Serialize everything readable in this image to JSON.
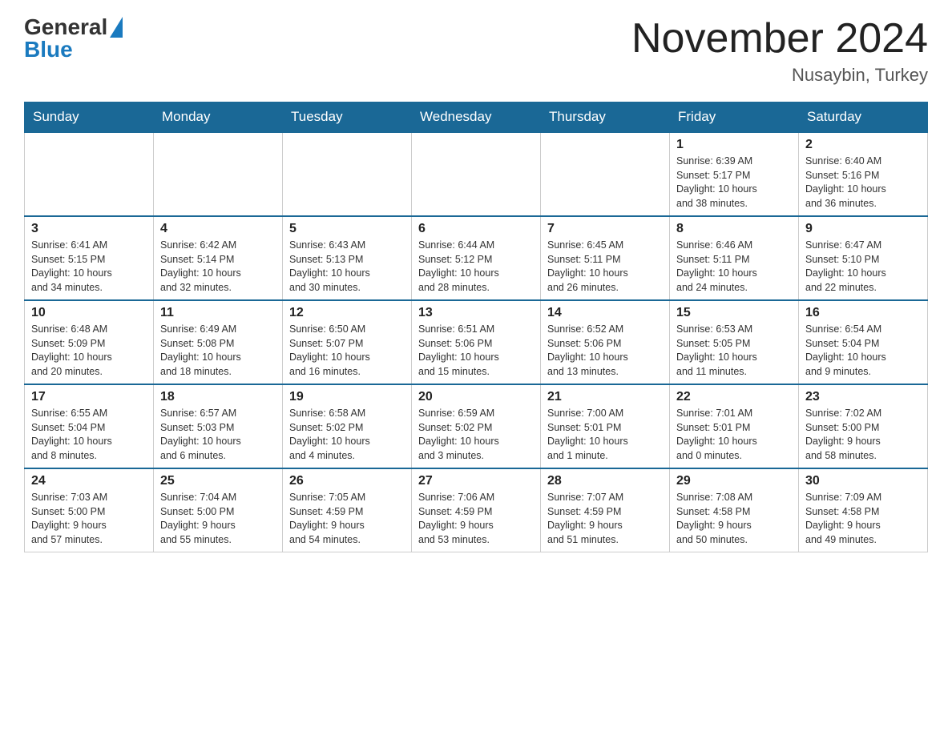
{
  "header": {
    "logo": {
      "general": "General",
      "blue": "Blue"
    },
    "title": "November 2024",
    "location": "Nusaybin, Turkey"
  },
  "calendar": {
    "days_of_week": [
      "Sunday",
      "Monday",
      "Tuesday",
      "Wednesday",
      "Thursday",
      "Friday",
      "Saturday"
    ],
    "weeks": [
      [
        {
          "day": "",
          "info": ""
        },
        {
          "day": "",
          "info": ""
        },
        {
          "day": "",
          "info": ""
        },
        {
          "day": "",
          "info": ""
        },
        {
          "day": "",
          "info": ""
        },
        {
          "day": "1",
          "info": "Sunrise: 6:39 AM\nSunset: 5:17 PM\nDaylight: 10 hours\nand 38 minutes."
        },
        {
          "day": "2",
          "info": "Sunrise: 6:40 AM\nSunset: 5:16 PM\nDaylight: 10 hours\nand 36 minutes."
        }
      ],
      [
        {
          "day": "3",
          "info": "Sunrise: 6:41 AM\nSunset: 5:15 PM\nDaylight: 10 hours\nand 34 minutes."
        },
        {
          "day": "4",
          "info": "Sunrise: 6:42 AM\nSunset: 5:14 PM\nDaylight: 10 hours\nand 32 minutes."
        },
        {
          "day": "5",
          "info": "Sunrise: 6:43 AM\nSunset: 5:13 PM\nDaylight: 10 hours\nand 30 minutes."
        },
        {
          "day": "6",
          "info": "Sunrise: 6:44 AM\nSunset: 5:12 PM\nDaylight: 10 hours\nand 28 minutes."
        },
        {
          "day": "7",
          "info": "Sunrise: 6:45 AM\nSunset: 5:11 PM\nDaylight: 10 hours\nand 26 minutes."
        },
        {
          "day": "8",
          "info": "Sunrise: 6:46 AM\nSunset: 5:11 PM\nDaylight: 10 hours\nand 24 minutes."
        },
        {
          "day": "9",
          "info": "Sunrise: 6:47 AM\nSunset: 5:10 PM\nDaylight: 10 hours\nand 22 minutes."
        }
      ],
      [
        {
          "day": "10",
          "info": "Sunrise: 6:48 AM\nSunset: 5:09 PM\nDaylight: 10 hours\nand 20 minutes."
        },
        {
          "day": "11",
          "info": "Sunrise: 6:49 AM\nSunset: 5:08 PM\nDaylight: 10 hours\nand 18 minutes."
        },
        {
          "day": "12",
          "info": "Sunrise: 6:50 AM\nSunset: 5:07 PM\nDaylight: 10 hours\nand 16 minutes."
        },
        {
          "day": "13",
          "info": "Sunrise: 6:51 AM\nSunset: 5:06 PM\nDaylight: 10 hours\nand 15 minutes."
        },
        {
          "day": "14",
          "info": "Sunrise: 6:52 AM\nSunset: 5:06 PM\nDaylight: 10 hours\nand 13 minutes."
        },
        {
          "day": "15",
          "info": "Sunrise: 6:53 AM\nSunset: 5:05 PM\nDaylight: 10 hours\nand 11 minutes."
        },
        {
          "day": "16",
          "info": "Sunrise: 6:54 AM\nSunset: 5:04 PM\nDaylight: 10 hours\nand 9 minutes."
        }
      ],
      [
        {
          "day": "17",
          "info": "Sunrise: 6:55 AM\nSunset: 5:04 PM\nDaylight: 10 hours\nand 8 minutes."
        },
        {
          "day": "18",
          "info": "Sunrise: 6:57 AM\nSunset: 5:03 PM\nDaylight: 10 hours\nand 6 minutes."
        },
        {
          "day": "19",
          "info": "Sunrise: 6:58 AM\nSunset: 5:02 PM\nDaylight: 10 hours\nand 4 minutes."
        },
        {
          "day": "20",
          "info": "Sunrise: 6:59 AM\nSunset: 5:02 PM\nDaylight: 10 hours\nand 3 minutes."
        },
        {
          "day": "21",
          "info": "Sunrise: 7:00 AM\nSunset: 5:01 PM\nDaylight: 10 hours\nand 1 minute."
        },
        {
          "day": "22",
          "info": "Sunrise: 7:01 AM\nSunset: 5:01 PM\nDaylight: 10 hours\nand 0 minutes."
        },
        {
          "day": "23",
          "info": "Sunrise: 7:02 AM\nSunset: 5:00 PM\nDaylight: 9 hours\nand 58 minutes."
        }
      ],
      [
        {
          "day": "24",
          "info": "Sunrise: 7:03 AM\nSunset: 5:00 PM\nDaylight: 9 hours\nand 57 minutes."
        },
        {
          "day": "25",
          "info": "Sunrise: 7:04 AM\nSunset: 5:00 PM\nDaylight: 9 hours\nand 55 minutes."
        },
        {
          "day": "26",
          "info": "Sunrise: 7:05 AM\nSunset: 4:59 PM\nDaylight: 9 hours\nand 54 minutes."
        },
        {
          "day": "27",
          "info": "Sunrise: 7:06 AM\nSunset: 4:59 PM\nDaylight: 9 hours\nand 53 minutes."
        },
        {
          "day": "28",
          "info": "Sunrise: 7:07 AM\nSunset: 4:59 PM\nDaylight: 9 hours\nand 51 minutes."
        },
        {
          "day": "29",
          "info": "Sunrise: 7:08 AM\nSunset: 4:58 PM\nDaylight: 9 hours\nand 50 minutes."
        },
        {
          "day": "30",
          "info": "Sunrise: 7:09 AM\nSunset: 4:58 PM\nDaylight: 9 hours\nand 49 minutes."
        }
      ]
    ]
  }
}
